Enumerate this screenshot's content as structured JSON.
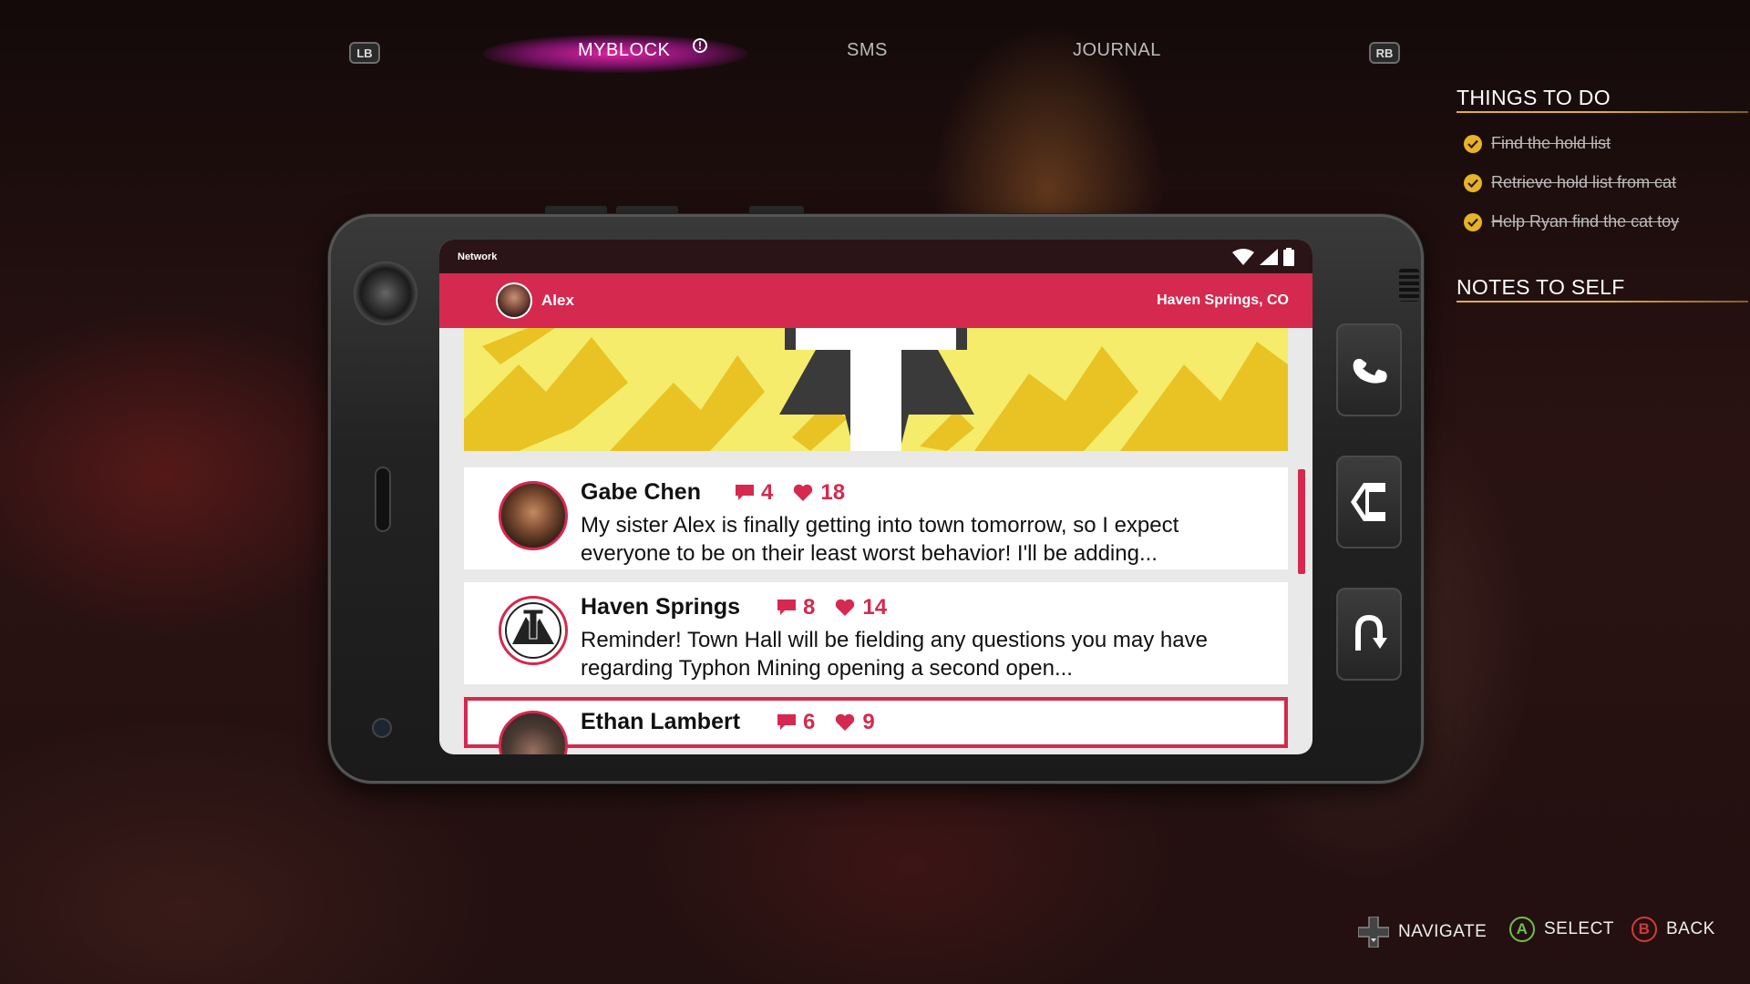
{
  "tabs": {
    "left_bumper": "LB",
    "right_bumper": "RB",
    "items": [
      {
        "label": "MYBLOCK",
        "active": true
      },
      {
        "label": "SMS",
        "active": false
      },
      {
        "label": "JOURNAL",
        "active": false
      }
    ],
    "alert_symbol": "!"
  },
  "things_to_do": {
    "title": "THINGS TO DO",
    "tasks": [
      {
        "label": "Find the hold list",
        "done": true
      },
      {
        "label": "Retrieve hold list from cat",
        "done": true
      },
      {
        "label": "Help Ryan find the cat toy",
        "done": true
      }
    ]
  },
  "notes": {
    "title": "NOTES TO SELF"
  },
  "phone": {
    "status_label": "Network",
    "user_name": "Alex",
    "location": "Haven Springs, CO",
    "posts": [
      {
        "author": "Gabe Chen",
        "comments": "4",
        "likes": "18",
        "text": "My sister Alex is finally getting into town tomorrow, so I expect everyone to be on their least worst behavior! I'll be adding..."
      },
      {
        "author": "Haven Springs",
        "comments": "8",
        "likes": "14",
        "text": "Reminder! Town Hall will be fielding any questions you may have regarding Typhon Mining opening a second open..."
      },
      {
        "author": "Ethan Lambert",
        "comments": "6",
        "likes": "9",
        "text": ""
      }
    ],
    "side_buttons": [
      "phone-icon",
      "app-switch-icon",
      "home-back-icon"
    ]
  },
  "hints": {
    "navigate": "NAVIGATE",
    "select_key": "A",
    "select": "SELECT",
    "back_key": "B",
    "back": "BACK"
  },
  "colors": {
    "accent": "#d5294f",
    "active_tab_glow": "#e028aa",
    "task_check": "#e6b328",
    "select_button": "#6fc04a",
    "back_button": "#d23a3a"
  }
}
